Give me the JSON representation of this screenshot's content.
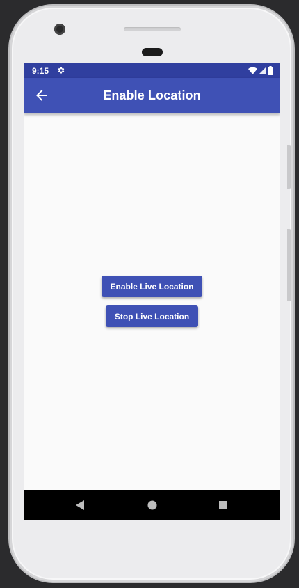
{
  "status_bar": {
    "time": "9:15",
    "icons": [
      "settings-gear-icon",
      "wifi-icon",
      "signal-icon",
      "battery-icon"
    ]
  },
  "app_bar": {
    "title": "Enable Location",
    "back_icon": "arrow-back-icon"
  },
  "main": {
    "enable_button_label": "Enable Live Location",
    "stop_button_label": "Stop Live Location"
  },
  "nav_bar": {
    "items": [
      "back-triangle-icon",
      "home-circle-icon",
      "recents-square-icon"
    ]
  },
  "colors": {
    "status_bar": "#303f9f",
    "app_bar": "#3f51b5",
    "button": "#3f51b5",
    "background": "#fafafa"
  }
}
